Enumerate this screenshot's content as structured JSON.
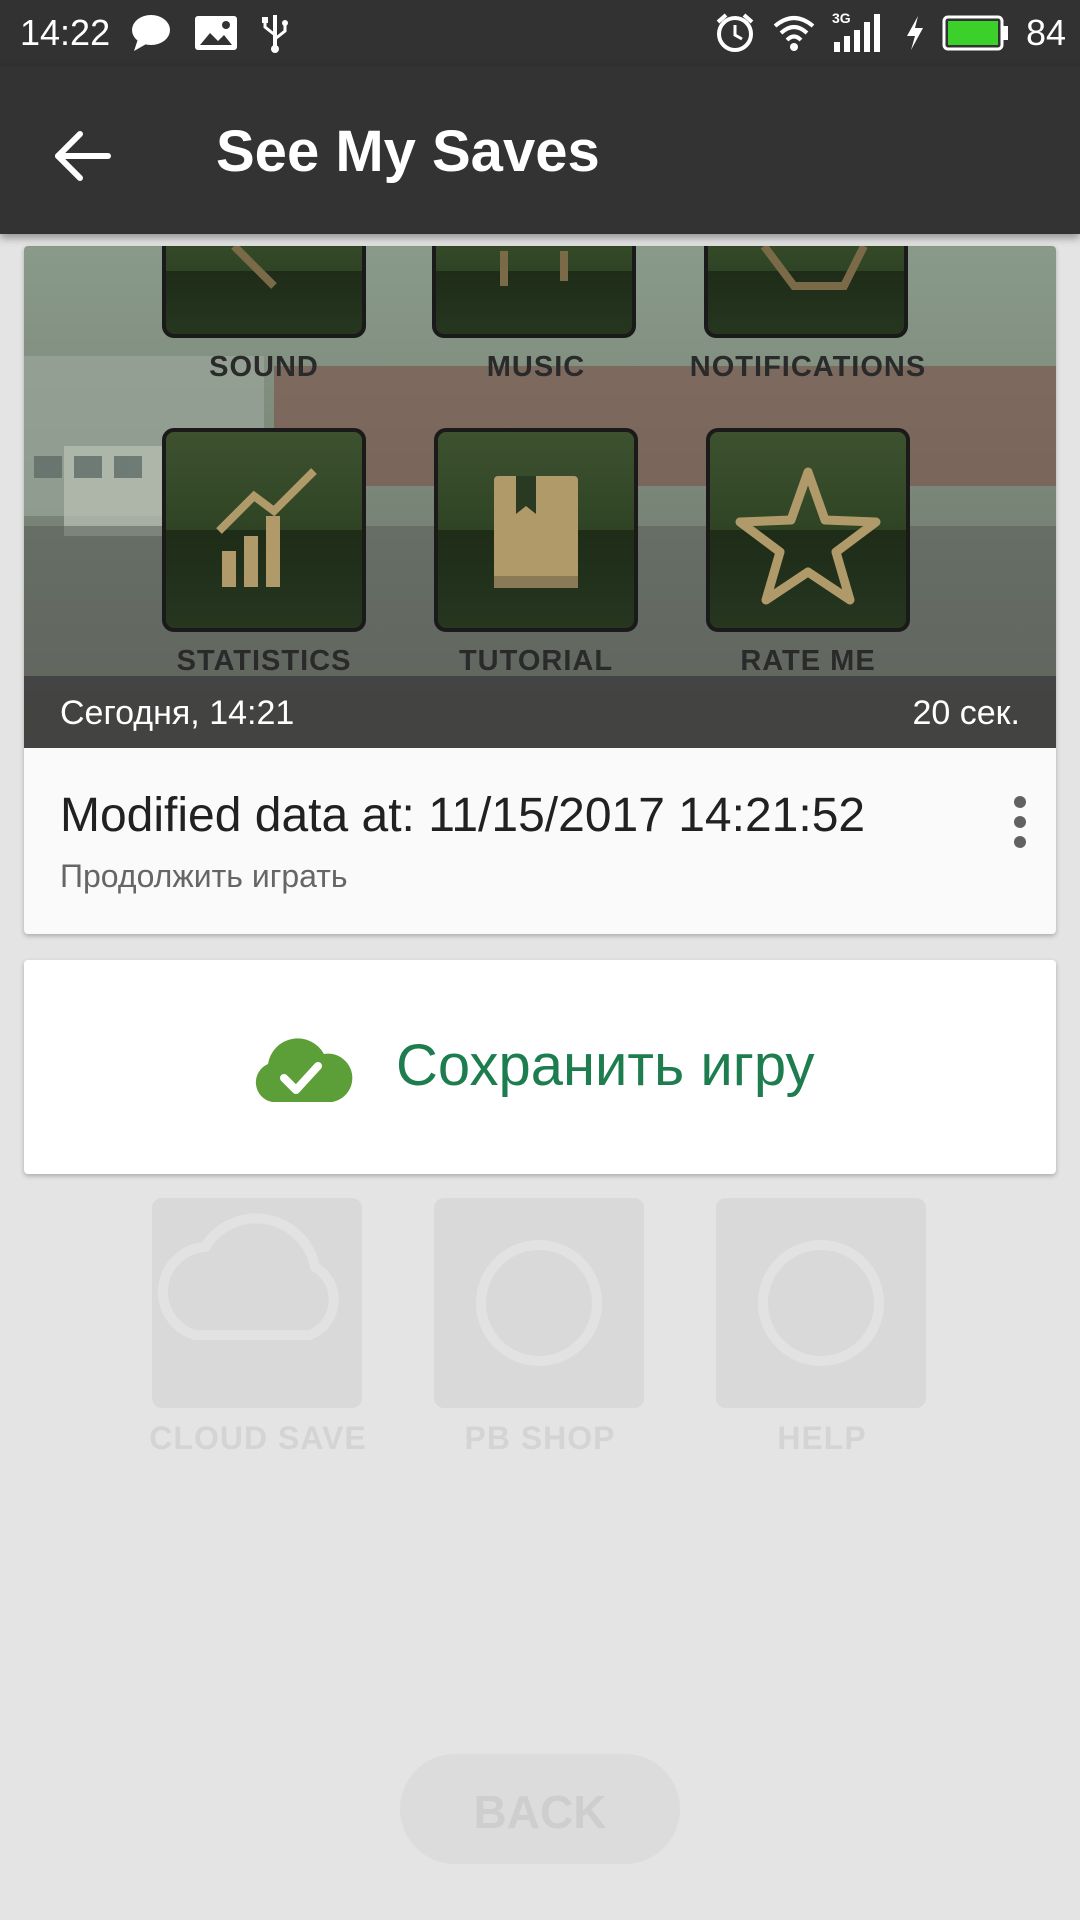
{
  "status_bar": {
    "time": "14:22",
    "battery_percent": "84",
    "network_label": "3G",
    "left_icons": [
      "message-icon",
      "image-icon",
      "usb-icon"
    ],
    "right_icons": [
      "alarm-icon",
      "wifi-icon",
      "signal-icon",
      "charging-icon",
      "battery-icon"
    ],
    "battery_color": "#3cd02a"
  },
  "app_bar": {
    "title": "See My Saves",
    "back_icon": "arrow-back-icon",
    "color": "#333333"
  },
  "snapshot": {
    "screenshot_tiles": {
      "row1": [
        "SOUND",
        "MUSIC",
        "NOTIFICATIONS"
      ],
      "row2": [
        "STATISTICS",
        "TUTORIAL",
        "RATE ME"
      ]
    },
    "date": "Сегодня, 14:21",
    "duration": "20 сек.",
    "title": "Modified data at: 11/15/2017 14:21:52",
    "subtitle": "Продолжить играть",
    "menu_icon": "more-vert-icon"
  },
  "save_button": {
    "label": "Сохранить игру",
    "icon": "cloud-check-icon",
    "accent": "#1e7d4e",
    "icon_color": "#5c9e37"
  },
  "background_screen": {
    "tiles": [
      "CLOUD SAVE",
      "PB SHOP",
      "HELP"
    ],
    "back_label": "BACK"
  }
}
